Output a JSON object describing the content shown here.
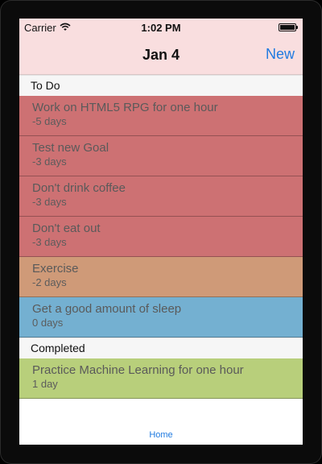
{
  "status_bar": {
    "carrier": "Carrier",
    "time": "1:02 PM",
    "wifi_icon": "wifi-icon",
    "battery_icon": "battery-icon"
  },
  "nav": {
    "title": "Jan 4",
    "right_button": "New"
  },
  "colors": {
    "red": "#cd7173",
    "orange": "#cf9a78",
    "blue": "#74b0d1",
    "green": "#b8cf7b",
    "accent": "#1f7ae0",
    "nav_bg": "#f9dedf"
  },
  "sections": [
    {
      "header": "To Do",
      "rows": [
        {
          "title": "Work on HTML5 RPG for one hour",
          "subtitle": "-5 days",
          "color": "#cd7173"
        },
        {
          "title": "Test new Goal",
          "subtitle": "-3 days",
          "color": "#cd7173"
        },
        {
          "title": "Don't drink coffee",
          "subtitle": "-3 days",
          "color": "#cd7173"
        },
        {
          "title": "Don't eat out",
          "subtitle": "-3 days",
          "color": "#cd7173"
        },
        {
          "title": "Exercise",
          "subtitle": "-2 days",
          "color": "#cf9a78"
        },
        {
          "title": "Get a good amount of sleep",
          "subtitle": "0 days",
          "color": "#74b0d1"
        }
      ]
    },
    {
      "header": "Completed",
      "rows": [
        {
          "title": "Practice Machine Learning for one hour",
          "subtitle": "1 day",
          "color": "#b8cf7b"
        }
      ]
    }
  ],
  "tab_bar": {
    "home_label": "Home"
  }
}
